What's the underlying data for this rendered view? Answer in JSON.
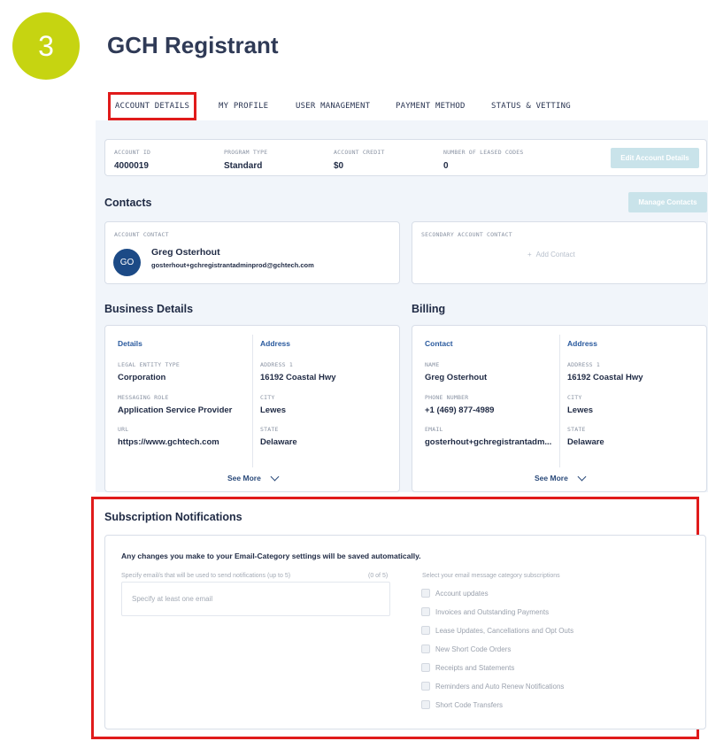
{
  "step": "3",
  "page_title": "GCH Registrant",
  "tabs": [
    {
      "label": "ACCOUNT DETAILS",
      "active": true
    },
    {
      "label": "MY PROFILE"
    },
    {
      "label": "USER MANAGEMENT"
    },
    {
      "label": "PAYMENT METHOD"
    },
    {
      "label": "STATUS & VETTING"
    }
  ],
  "account": {
    "id_label": "ACCOUNT ID",
    "id": "4000019",
    "program_label": "PROGRAM TYPE",
    "program": "Standard",
    "credit_label": "ACCOUNT CREDIT",
    "credit": "$0",
    "leased_label": "NUMBER OF LEASED CODES",
    "leased": "0",
    "edit_button": "Edit Account Details"
  },
  "contacts": {
    "title": "Contacts",
    "manage_button": "Manage Contacts",
    "primary_label": "ACCOUNT CONTACT",
    "avatar_initials": "GO",
    "name": "Greg Osterhout",
    "email": "gosterhout+gchregistrantadminprod@gchtech.com",
    "secondary_label": "SECONDARY ACCOUNT CONTACT",
    "add_contact": "Add Contact"
  },
  "business": {
    "title": "Business Details",
    "details_head": "Details",
    "address_head": "Address",
    "legal_label": "LEGAL ENTITY TYPE",
    "legal": "Corporation",
    "role_label": "MESSAGING ROLE",
    "role": "Application Service Provider",
    "url_label": "URL",
    "url": "https://www.gchtech.com",
    "addr1_label": "ADDRESS 1",
    "addr1": "16192 Coastal Hwy",
    "city_label": "CITY",
    "city": "Lewes",
    "state_label": "STATE",
    "state": "Delaware",
    "see_more": "See More"
  },
  "billing": {
    "title": "Billing",
    "contact_head": "Contact",
    "address_head": "Address",
    "name_label": "NAME",
    "name": "Greg Osterhout",
    "phone_label": "PHONE NUMBER",
    "phone": "+1 (469) 877-4989",
    "email_label": "EMAIL",
    "email": "gosterhout+gchregistrantadm...",
    "addr1_label": "ADDRESS 1",
    "addr1": "16192 Coastal Hwy",
    "city_label": "CITY",
    "city": "Lewes",
    "state_label": "STATE",
    "state": "Delaware",
    "see_more": "See More"
  },
  "subscriptions": {
    "title": "Subscription Notifications",
    "notice": "Any changes you make to your Email-Category settings will be saved automatically.",
    "email_hint": "Specify email/s that will be used to send notifications (up to 5)",
    "email_count": "(0 of 5)",
    "email_placeholder": "Specify at least one email",
    "category_hint": "Select your email message category subscriptions",
    "categories": [
      "Account updates",
      "Invoices and Outstanding Payments",
      "Lease Updates, Cancellations and Opt Outs",
      "New Short Code Orders",
      "Receipts and Statements",
      "Reminders and Auto Renew Notifications",
      "Short Code Transfers"
    ]
  }
}
